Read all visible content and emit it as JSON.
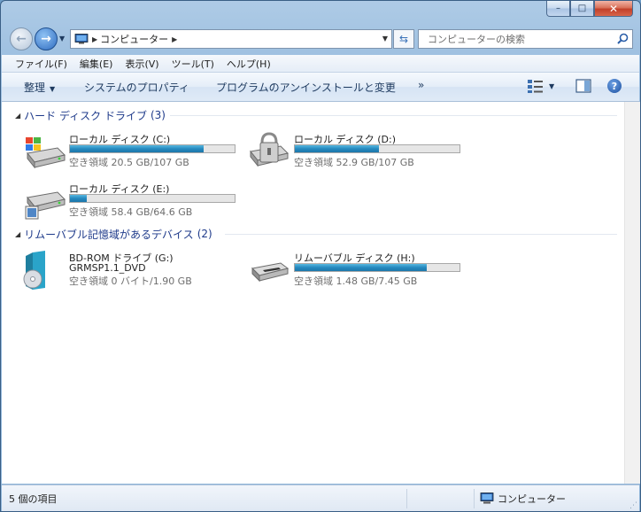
{
  "window": {
    "caption_buttons": {
      "minimize": "–",
      "maximize": "□",
      "close": "✕"
    }
  },
  "nav": {
    "breadcrumb": "コンピューター",
    "search_placeholder": "コンピューターの検索"
  },
  "menubar": {
    "items": [
      "ファイル(F)",
      "編集(E)",
      "表示(V)",
      "ツール(T)",
      "ヘルプ(H)"
    ]
  },
  "toolbar": {
    "organize": "整理",
    "system_properties": "システムのプロパティ",
    "uninstall": "プログラムのアンインストールと変更",
    "more": "»"
  },
  "groups": [
    {
      "title": "ハード ディスク ドライブ",
      "count": "(3)",
      "drives": [
        {
          "name": "ローカル ディスク (C:)",
          "free_text": "空き領域 20.5 GB/107 GB",
          "used_fraction": 0.81,
          "icon": "windows-drive-icon"
        },
        {
          "name": "ローカル ディスク (D:)",
          "free_text": "空き領域 52.9 GB/107 GB",
          "used_fraction": 0.51,
          "icon": "locked-drive-icon"
        },
        {
          "name": "ローカル ディスク (E:)",
          "free_text": "空き領域 58.4 GB/64.6 GB",
          "used_fraction": 0.1,
          "icon": "drive-icon"
        }
      ]
    },
    {
      "title": "リムーバブル記憶域があるデバイス",
      "count": "(2)",
      "drives": [
        {
          "name": "BD-ROM ドライブ (G:)",
          "label": "GRMSP1.1_DVD",
          "free_text": "空き領域 0 バイト/1.90 GB",
          "icon": "dvd-drive-icon"
        },
        {
          "name": "リムーバブル ディスク (H:)",
          "free_text": "空き領域 1.48 GB/7.45 GB",
          "used_fraction": 0.8,
          "icon": "removable-drive-icon"
        }
      ]
    }
  ],
  "status": {
    "item_count": "5 個の項目",
    "location": "コンピューター"
  },
  "colors": {
    "bar_fill": "#2689bf",
    "group_header": "#1e3a8a"
  }
}
